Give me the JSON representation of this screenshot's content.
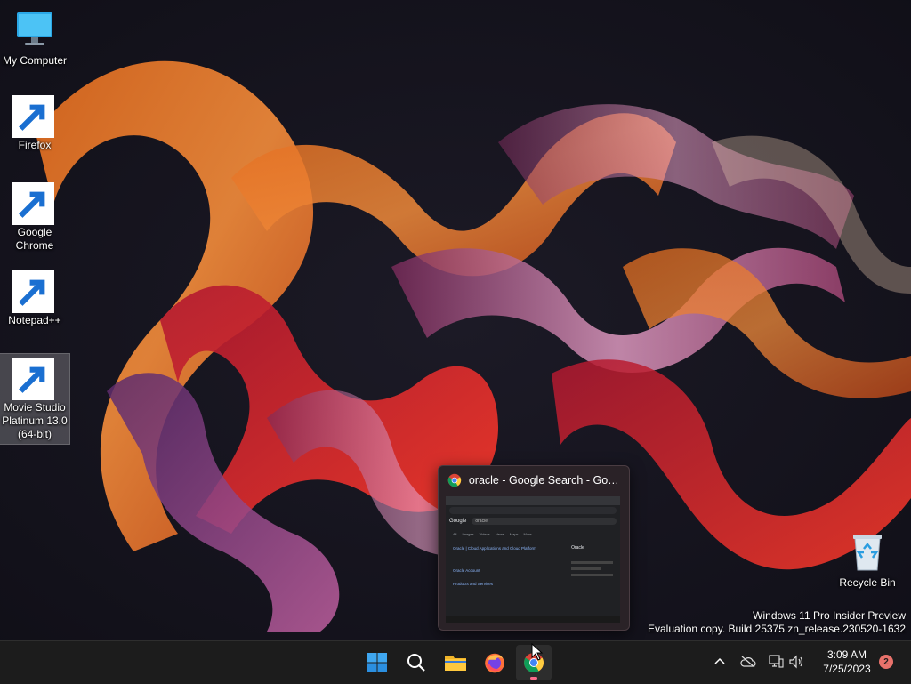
{
  "desktop": {
    "icons": [
      {
        "label": "My Computer",
        "icon": "monitor-icon"
      },
      {
        "label": "Firefox",
        "icon": "firefox-icon"
      },
      {
        "label": "Google Chrome",
        "icon": "chrome-icon"
      },
      {
        "label": "Notepad++",
        "icon": "notepad-plus-plus-icon"
      },
      {
        "label": "Movie Studio Platinum 13.0 (64-bit)",
        "icon": "movie-studio-icon"
      },
      {
        "label": "Recycle Bin",
        "icon": "recycle-bin-icon"
      }
    ]
  },
  "watermark": {
    "line1": "Windows 11 Pro Insider Preview",
    "line2": "Evaluation copy. Build 25375.zn_release.230520-1632"
  },
  "preview": {
    "title": "oracle - Google Search - Googl...",
    "thumb": {
      "brand": "Google",
      "query": "oracle",
      "tabs": [
        "All",
        "Images",
        "Videos",
        "News",
        "Maps",
        "More"
      ],
      "results": [
        "Oracle | Cloud Applications and Cloud Platform",
        "Oracle Account",
        "Products and Services"
      ],
      "panel_title": "Oracle"
    }
  },
  "taskbar": {
    "items": [
      {
        "name": "start",
        "icon": "windows-logo-icon"
      },
      {
        "name": "search",
        "icon": "search-icon"
      },
      {
        "name": "file-explorer",
        "icon": "folder-icon"
      },
      {
        "name": "firefox",
        "icon": "firefox-icon"
      },
      {
        "name": "chrome",
        "icon": "chrome-icon",
        "active": true
      }
    ],
    "tray": {
      "icons": [
        "chevron-up-icon",
        "cloud-offline-icon",
        "network-icon",
        "volume-icon"
      ],
      "time": "3:09 AM",
      "date": "7/25/2023",
      "notifications": "2"
    }
  },
  "colors": {
    "taskbar": "#1c1c1c",
    "accent": "#ff6b8a",
    "badge": "#e8726b"
  }
}
